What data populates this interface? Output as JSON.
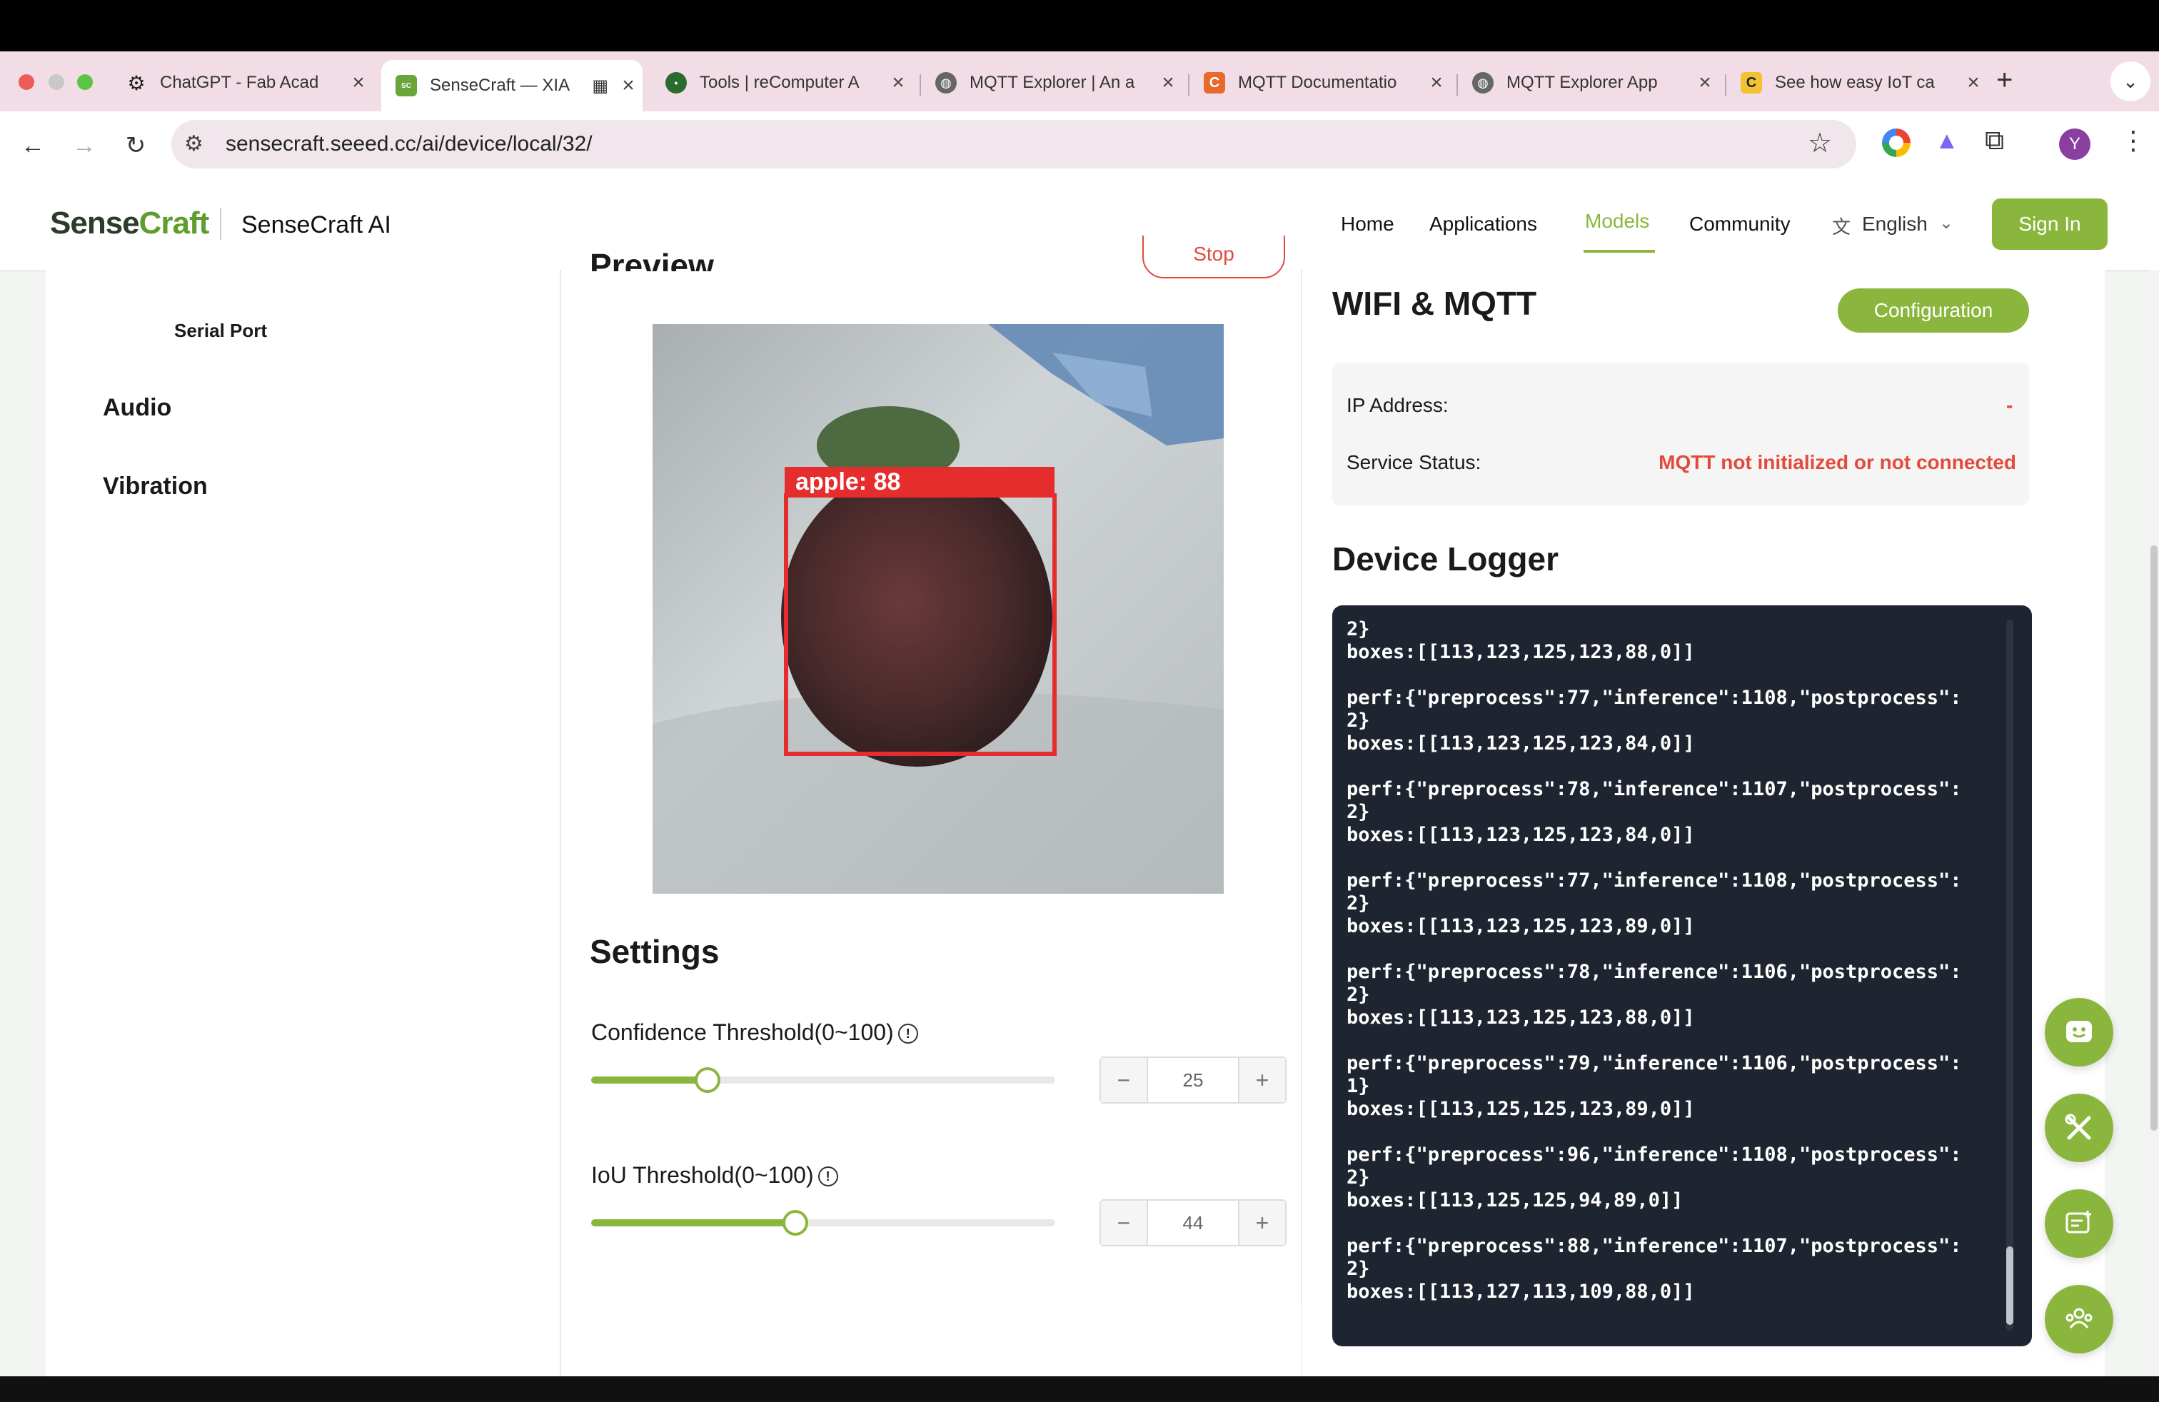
{
  "browser": {
    "tabs": [
      {
        "label": "ChatGPT - Fab Acad",
        "favicon": "chatgpt-icon"
      },
      {
        "label": "SenseCraft — XIA",
        "favicon": "sensecraft-icon",
        "active": true
      },
      {
        "label": "Tools | reComputer A",
        "favicon": "seeed-studio-icon"
      },
      {
        "label": "MQTT Explorer | An a",
        "favicon": "globe-icon"
      },
      {
        "label": "MQTT Documentatio",
        "favicon": "c-icon"
      },
      {
        "label": "MQTT Explorer App",
        "favicon": "globe-icon"
      },
      {
        "label": "See how easy IoT ca",
        "favicon": "c-icon"
      }
    ],
    "url": "sensecraft.seeed.cc/ai/device/local/32/",
    "profile_initial": "Y"
  },
  "header": {
    "logo_main": "Sense",
    "logo_accent": "Craft",
    "site_name": "SenseCraft AI",
    "nav": [
      "Home",
      "Applications",
      "Models",
      "Community"
    ],
    "active_nav": "Models",
    "language": "English",
    "sign_in": "Sign In"
  },
  "left_menu": {
    "serial_port": "Serial Port",
    "audio": "Audio",
    "vibration": "Vibration"
  },
  "preview": {
    "title": "Preview",
    "stop_label": "Stop",
    "detection_label": "apple: 88"
  },
  "settings": {
    "title": "Settings",
    "confidence": {
      "label": "Confidence Threshold(0~100)",
      "value": "25",
      "fraction": 0.25
    },
    "iou": {
      "label": "IoU Threshold(0~100)",
      "value": "44",
      "fraction": 0.44
    },
    "minus": "−",
    "plus": "+"
  },
  "wifi_mqtt": {
    "title": "WIFI & MQTT",
    "config_button": "Configuration",
    "ip_label": "IP Address:",
    "ip_value": "-",
    "status_label": "Service Status:",
    "status_value": "MQTT not initialized or not connected"
  },
  "logger": {
    "title": "Device Logger",
    "lines": [
      "2}",
      "boxes:[[113,123,125,123,88,0]]",
      "",
      "perf:{\"preprocess\":77,\"inference\":1108,\"postprocess\":",
      "2}",
      "boxes:[[113,123,125,123,84,0]]",
      "",
      "perf:{\"preprocess\":78,\"inference\":1107,\"postprocess\":",
      "2}",
      "boxes:[[113,123,125,123,84,0]]",
      "",
      "perf:{\"preprocess\":77,\"inference\":1108,\"postprocess\":",
      "2}",
      "boxes:[[113,123,125,123,89,0]]",
      "",
      "perf:{\"preprocess\":78,\"inference\":1106,\"postprocess\":",
      "2}",
      "boxes:[[113,123,125,123,88,0]]",
      "",
      "perf:{\"preprocess\":79,\"inference\":1106,\"postprocess\":",
      "1}",
      "boxes:[[113,125,125,123,89,0]]",
      "",
      "perf:{\"preprocess\":96,\"inference\":1108,\"postprocess\":",
      "2}",
      "boxes:[[113,125,125,94,89,0]]",
      "",
      "perf:{\"preprocess\":88,\"inference\":1107,\"postprocess\":",
      "2}",
      "boxes:[[113,127,113,109,88,0]]"
    ]
  },
  "colors": {
    "accent_green": "#8bb63d",
    "error_red": "#e24b3b",
    "logger_bg": "#1f2530"
  },
  "fabs": [
    "feedback-smile-icon",
    "tools-icon",
    "post-add-icon",
    "community-icon"
  ]
}
